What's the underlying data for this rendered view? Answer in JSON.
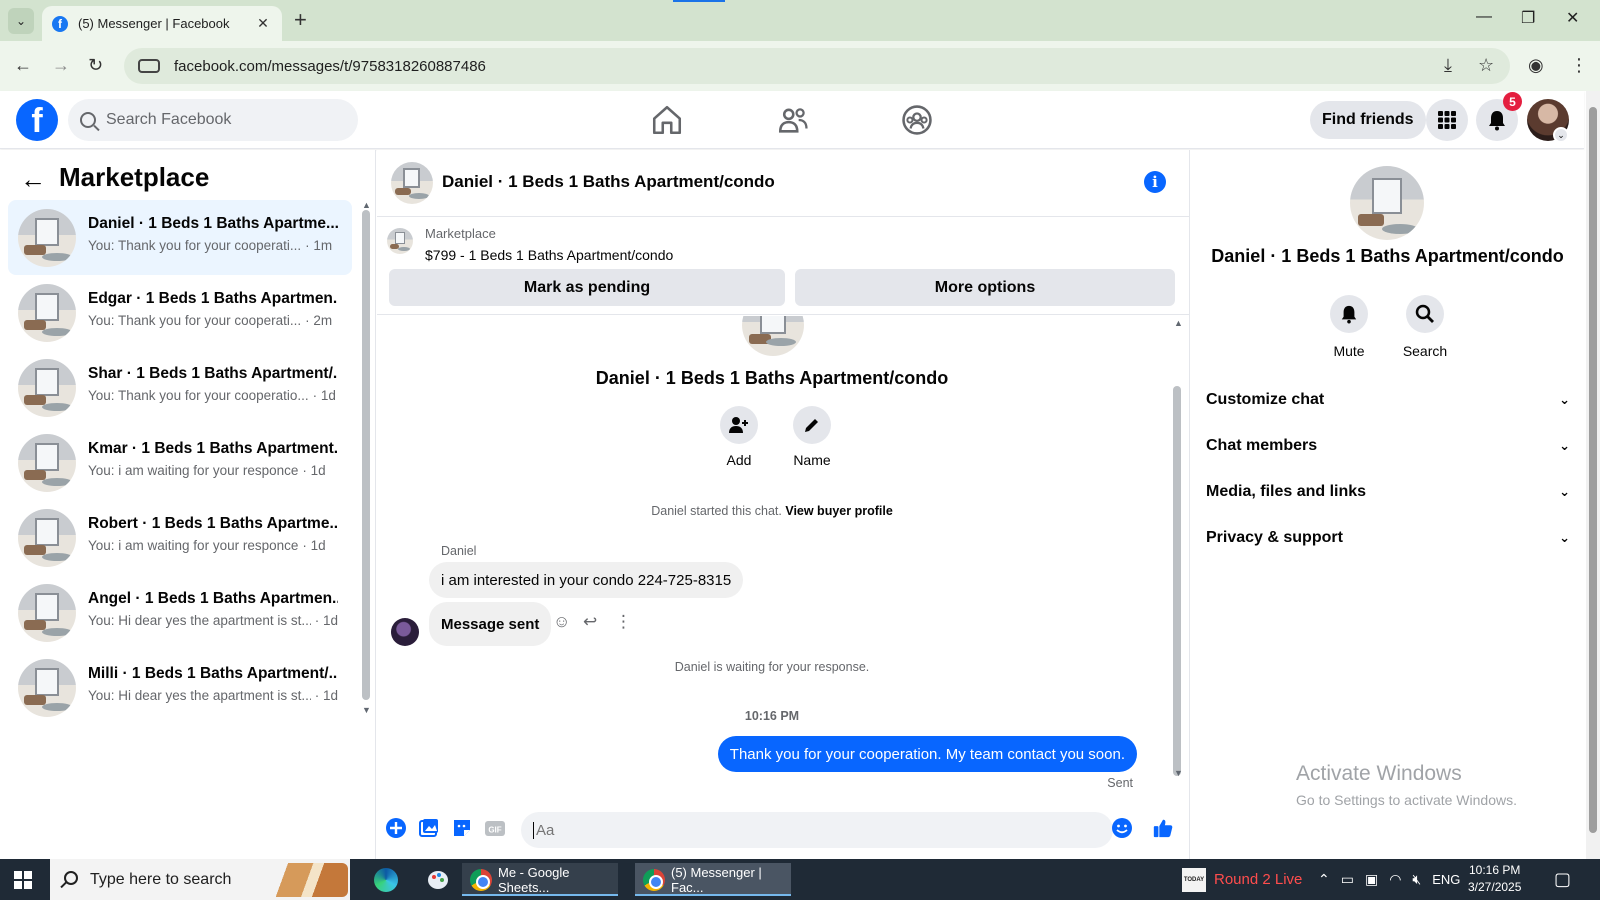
{
  "browser": {
    "tab_title": "(5) Messenger | Facebook",
    "url": "facebook.com/messages/t/9758318260887486",
    "favicon_letter": "f"
  },
  "fb_header": {
    "logo_letter": "f",
    "search_placeholder": "Search Facebook",
    "find_friends_label": "Find friends",
    "notifications_count": "5"
  },
  "left_panel": {
    "title": "Marketplace",
    "conversations": [
      {
        "name": "Daniel · 1 Beds 1 Baths Apartme...",
        "preview": "You: Thank you for your cooperati...",
        "time": "· 1m"
      },
      {
        "name": "Edgar · 1 Beds 1 Baths Apartmen...",
        "preview": "You: Thank you for your cooperati...",
        "time": "· 2m"
      },
      {
        "name": "Shar · 1 Beds 1 Baths Apartment/...",
        "preview": "You: Thank you for your cooperatio...",
        "time": "· 1d"
      },
      {
        "name": "Kmar · 1 Beds 1 Baths Apartment...",
        "preview": "You: i am waiting for your responce",
        "time": "· 1d"
      },
      {
        "name": "Robert · 1 Beds 1 Baths Apartme...",
        "preview": "You: i am waiting for your responce",
        "time": "· 1d"
      },
      {
        "name": "Angel · 1 Beds 1 Baths Apartmen...",
        "preview": "You: Hi dear yes the apartment is st...",
        "time": "· 1d"
      },
      {
        "name": "Milli · 1 Beds 1 Baths Apartment/...",
        "preview": "You: Hi dear yes the apartment is st...",
        "time": "· 1d"
      }
    ]
  },
  "chat": {
    "title": "Daniel · 1 Beds 1 Baths Apartment/condo",
    "marketplace_label": "Marketplace",
    "listing": "$799 - 1 Beds 1 Baths Apartment/condo",
    "mark_pending_label": "Mark as pending",
    "more_options_label": "More options",
    "center_title": "Daniel · 1 Beds 1 Baths Apartment/condo",
    "add_label": "Add",
    "name_label": "Name",
    "started_text": "Daniel started this chat.",
    "view_buyer_profile": "View buyer profile",
    "sender_name": "Daniel",
    "incoming_message": "i am interested in your condo 224-725-8315",
    "message_sent_text": "Message sent",
    "waiting_text": "Daniel is waiting for your response.",
    "timestamp": "10:16 PM",
    "outgoing_message": "Thank you for your cooperation. My team contact you soon.",
    "sent_status": "Sent",
    "composer_placeholder": "Aa"
  },
  "right_panel": {
    "name": "Daniel · 1 Beds 1 Baths Apartment/condo",
    "mute_label": "Mute",
    "search_label": "Search",
    "sections": [
      "Customize chat",
      "Chat members",
      "Media, files and links",
      "Privacy & support"
    ],
    "activate_title": "Activate Windows",
    "activate_sub": "Go to Settings to activate Windows."
  },
  "taskbar": {
    "search_placeholder": "Type here to search",
    "app1": "Me - Google Sheets...",
    "app2": "(5) Messenger | Fac...",
    "tray_app": "Round 2 Live",
    "tray_app_icon_text": "TODAY",
    "lang": "ENG",
    "time": "10:16 PM",
    "date": "3/27/2025"
  },
  "colors": {
    "fb_blue": "#0866ff",
    "tab_bar": "#d3e3cf",
    "taskbar": "#1f2a36",
    "badge_red": "#e41e3f"
  }
}
